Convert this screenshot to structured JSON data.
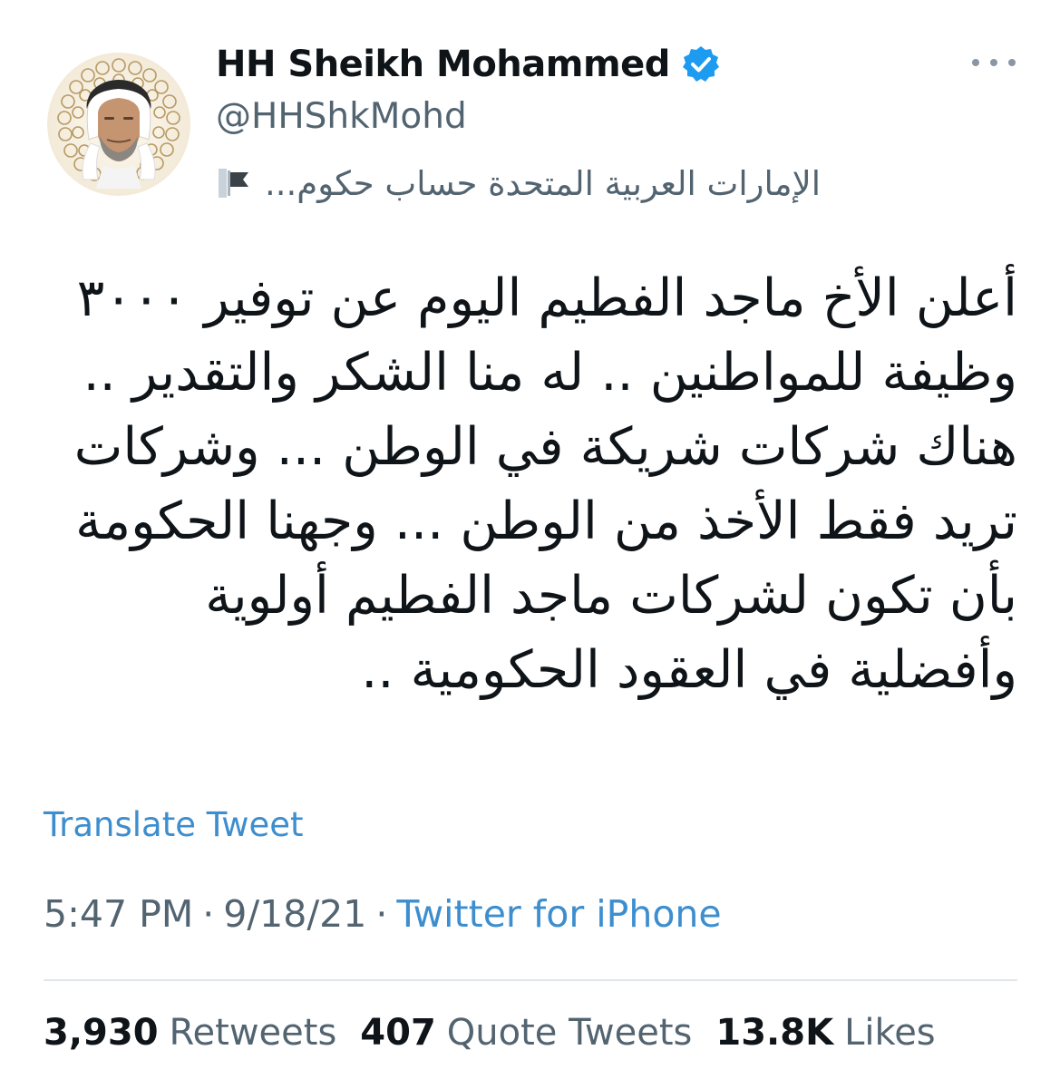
{
  "author": {
    "display_name": "HH Sheikh Mohammed",
    "handle": "@HHShkMohd",
    "affiliation": "الإمارات العربية المتحدة حساب حكوم...",
    "verified_icon": "verified-badge",
    "affiliation_icon": "flag-icon",
    "avatar_icon": "profile-photo"
  },
  "more_menu_icon": "more-horizontal-icon",
  "tweet": {
    "lines": [
      "أعلن الأخ ماجد الفطيم اليوم عن توفير ٣٠٠٠",
      "وظيفة للمواطنين .. له منا الشكر والتقدير ..",
      "هناك شركات شريكة في الوطن ... وشركات",
      "تريد فقط الأخذ من الوطن ... وجهنا الحكومة",
      "بأن تكون لشركات ماجد الفطيم أولوية",
      "وأفضلية في العقود الحكومية .."
    ]
  },
  "translate_label": "Translate Tweet",
  "meta": {
    "time": "5:47 PM",
    "separator": "·",
    "date": "9/18/21",
    "source": "Twitter for iPhone"
  },
  "stats": {
    "retweets": {
      "count": "3,930",
      "label": "Retweets"
    },
    "quote_tweets": {
      "count": "407",
      "label": "Quote Tweets"
    },
    "likes": {
      "count": "13.8K",
      "label": "Likes"
    }
  },
  "colors": {
    "text_primary": "#0f1419",
    "text_secondary": "#536471",
    "link": "#3d8ecf",
    "verified_blue": "#1d9bf0",
    "divider": "#e1e6ea"
  }
}
